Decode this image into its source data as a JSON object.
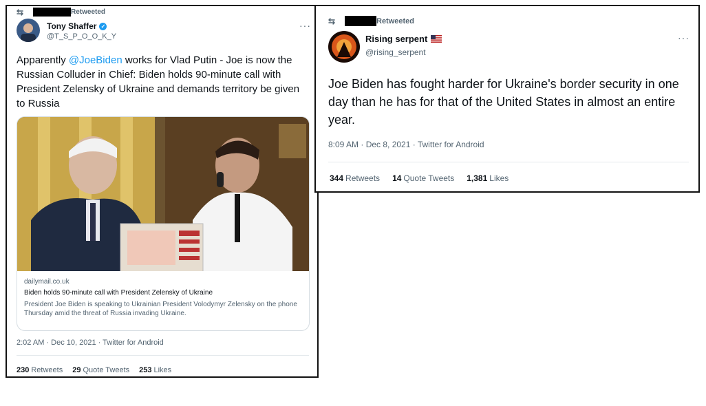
{
  "left_tweet": {
    "retweet_label": "Retweeted",
    "author_name": "Tony Shaffer",
    "author_handle": "@T_S_P_O_O_K_Y",
    "tweet_text_before_link": "Apparently ",
    "mention": "@JoeBiden",
    "tweet_text_after_link": " works for Vlad Putin - Joe is now the Russian Colluder in Chief: Biden holds 90-minute call with President Zelensky of Ukraine and demands territory be given to Russia",
    "link_card": {
      "domain": "dailymail.co.uk",
      "title": "Biden holds 90-minute call with President Zelensky of Ukraine",
      "description": "President Joe Biden is speaking to Ukrainian President Volodymyr Zelensky on the phone Thursday amid the threat of Russia invading Ukraine."
    },
    "timestamp": "2:02 AM · Dec 10, 2021 · Twitter for Android",
    "retweets_count": "230",
    "retweets_label": "Retweets",
    "quote_count": "29",
    "quote_label": "Quote Tweets",
    "likes_count": "253",
    "likes_label": "Likes"
  },
  "right_tweet": {
    "retweet_label": "Retweeted",
    "author_name": "Rising serpent",
    "author_handle": "@rising_serpent",
    "tweet_text": "Joe Biden has fought harder for Ukraine's border security in one day than he has for that of the United States in almost an entire year.",
    "timestamp": "8:09 AM · Dec 8, 2021 · Twitter for Android",
    "retweets_count": "344",
    "retweets_label": "Retweets",
    "quote_count": "14",
    "quote_label": "Quote Tweets",
    "likes_count": "1,381",
    "likes_label": "Likes"
  },
  "colors": {
    "link_blue": "#1d9bf0",
    "secondary_text": "#536471",
    "redaction": "#000000"
  }
}
